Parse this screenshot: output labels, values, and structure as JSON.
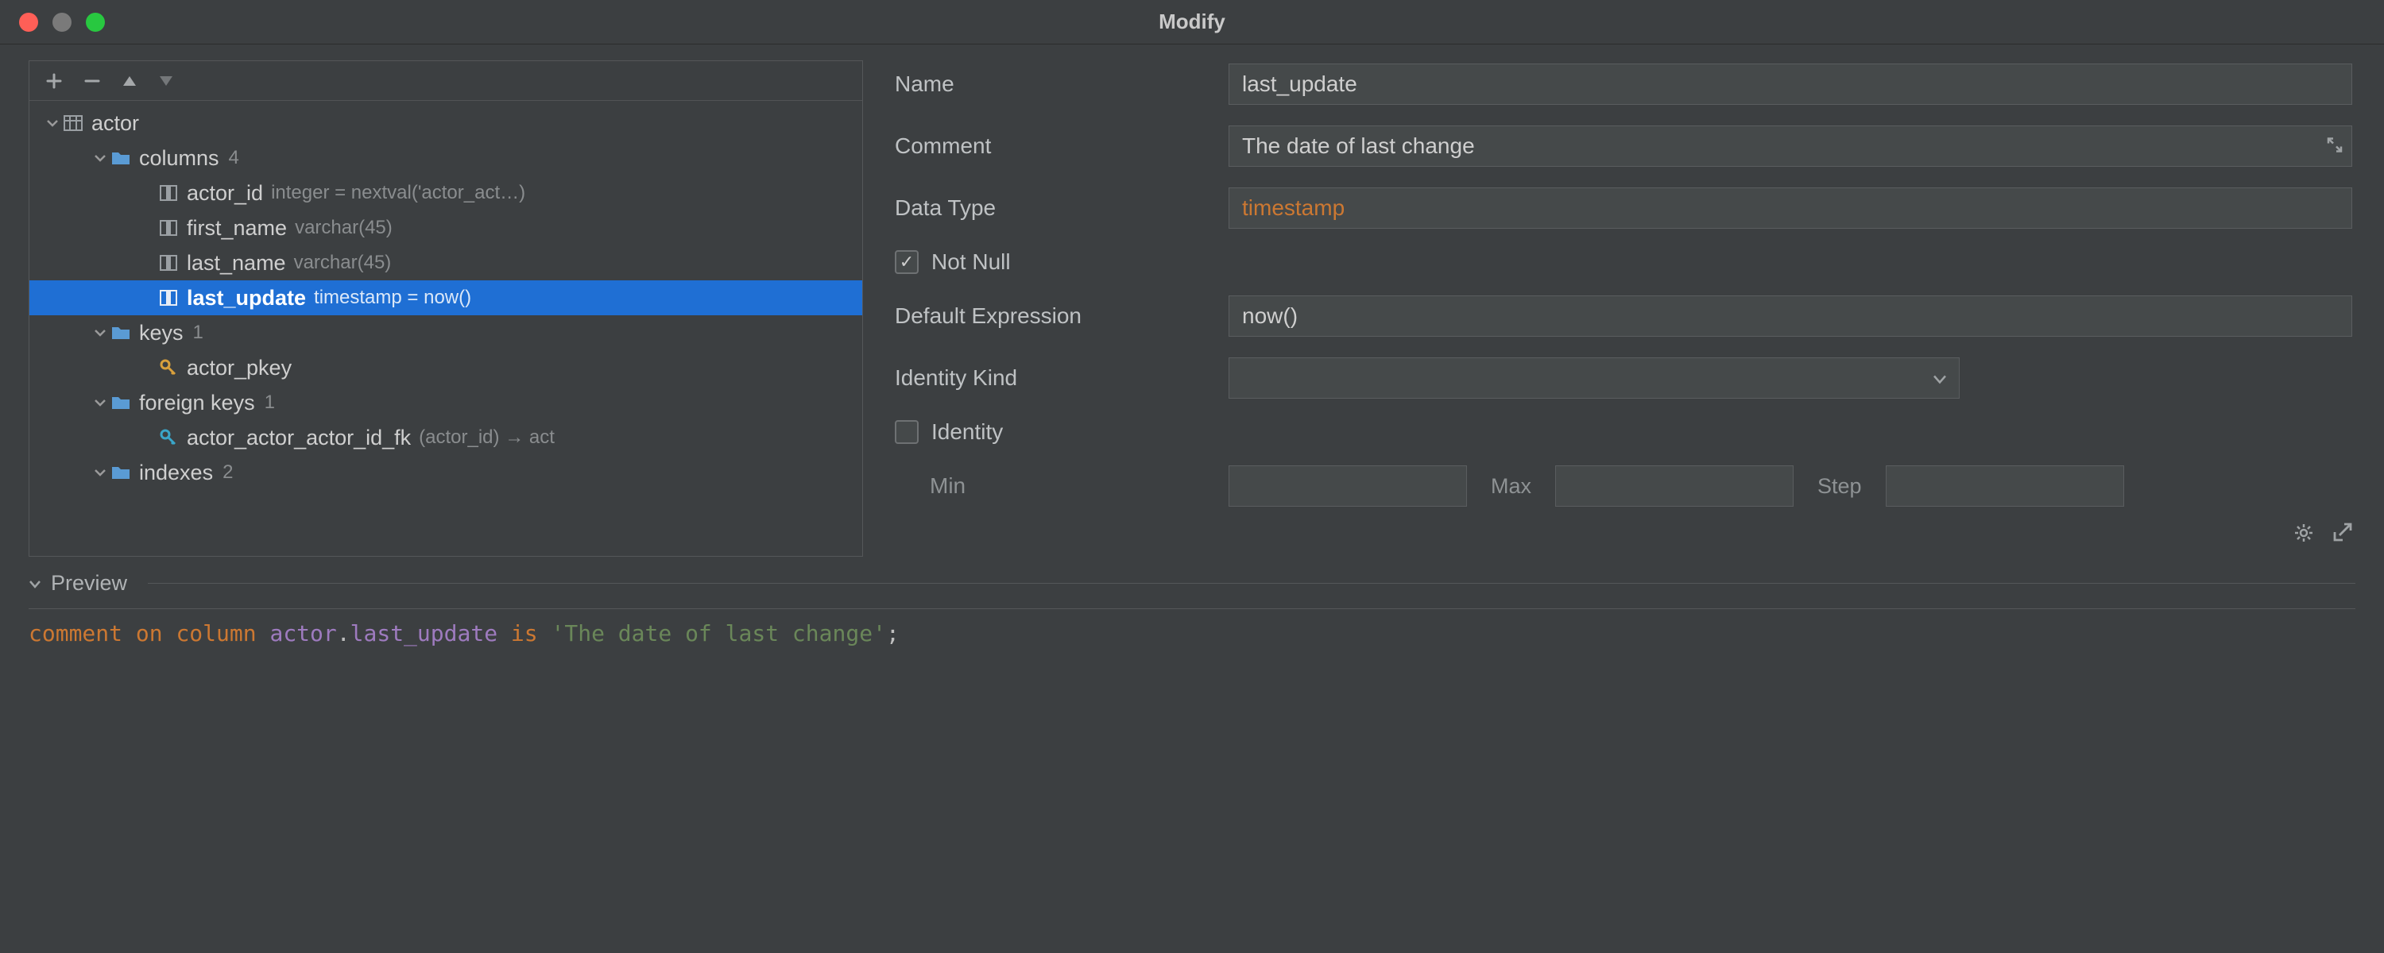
{
  "window": {
    "title": "Modify"
  },
  "tree": {
    "root": {
      "label": "actor",
      "groups": {
        "columns": {
          "label": "columns",
          "count": "4"
        },
        "keys": {
          "label": "keys",
          "count": "1"
        },
        "foreign_keys": {
          "label": "foreign keys",
          "count": "1"
        },
        "indexes": {
          "label": "indexes",
          "count": "2"
        }
      },
      "columns": [
        {
          "name": "actor_id",
          "meta": "integer = nextval('actor_act…)"
        },
        {
          "name": "first_name",
          "meta": "varchar(45)"
        },
        {
          "name": "last_name",
          "meta": "varchar(45)"
        },
        {
          "name": "last_update",
          "meta": "timestamp = now()"
        }
      ],
      "keys": [
        {
          "name": "actor_pkey"
        }
      ],
      "foreign_keys": [
        {
          "name": "actor_actor_actor_id_fk",
          "meta": "(actor_id) → act"
        }
      ]
    }
  },
  "form": {
    "name": {
      "label": "Name",
      "value": "last_update"
    },
    "comment": {
      "label": "Comment",
      "value": "The date of last change"
    },
    "datatype": {
      "label": "Data Type",
      "value": "timestamp"
    },
    "not_null": {
      "label": "Not Null",
      "checked": true
    },
    "default_expr": {
      "label": "Default Expression",
      "value": "now()"
    },
    "identity_kind": {
      "label": "Identity Kind",
      "value": ""
    },
    "identity": {
      "label": "Identity",
      "checked": false
    },
    "min": {
      "label": "Min",
      "value": ""
    },
    "max": {
      "label": "Max",
      "value": ""
    },
    "step": {
      "label": "Step",
      "value": ""
    }
  },
  "preview": {
    "label": "Preview",
    "sql": {
      "kw1": "comment",
      "kw2": "on",
      "kw3": "column",
      "tbl": "actor",
      "dot": ".",
      "col": "last_update",
      "kw4": "is",
      "str": "'The date of last change'",
      "semi": ";"
    }
  }
}
